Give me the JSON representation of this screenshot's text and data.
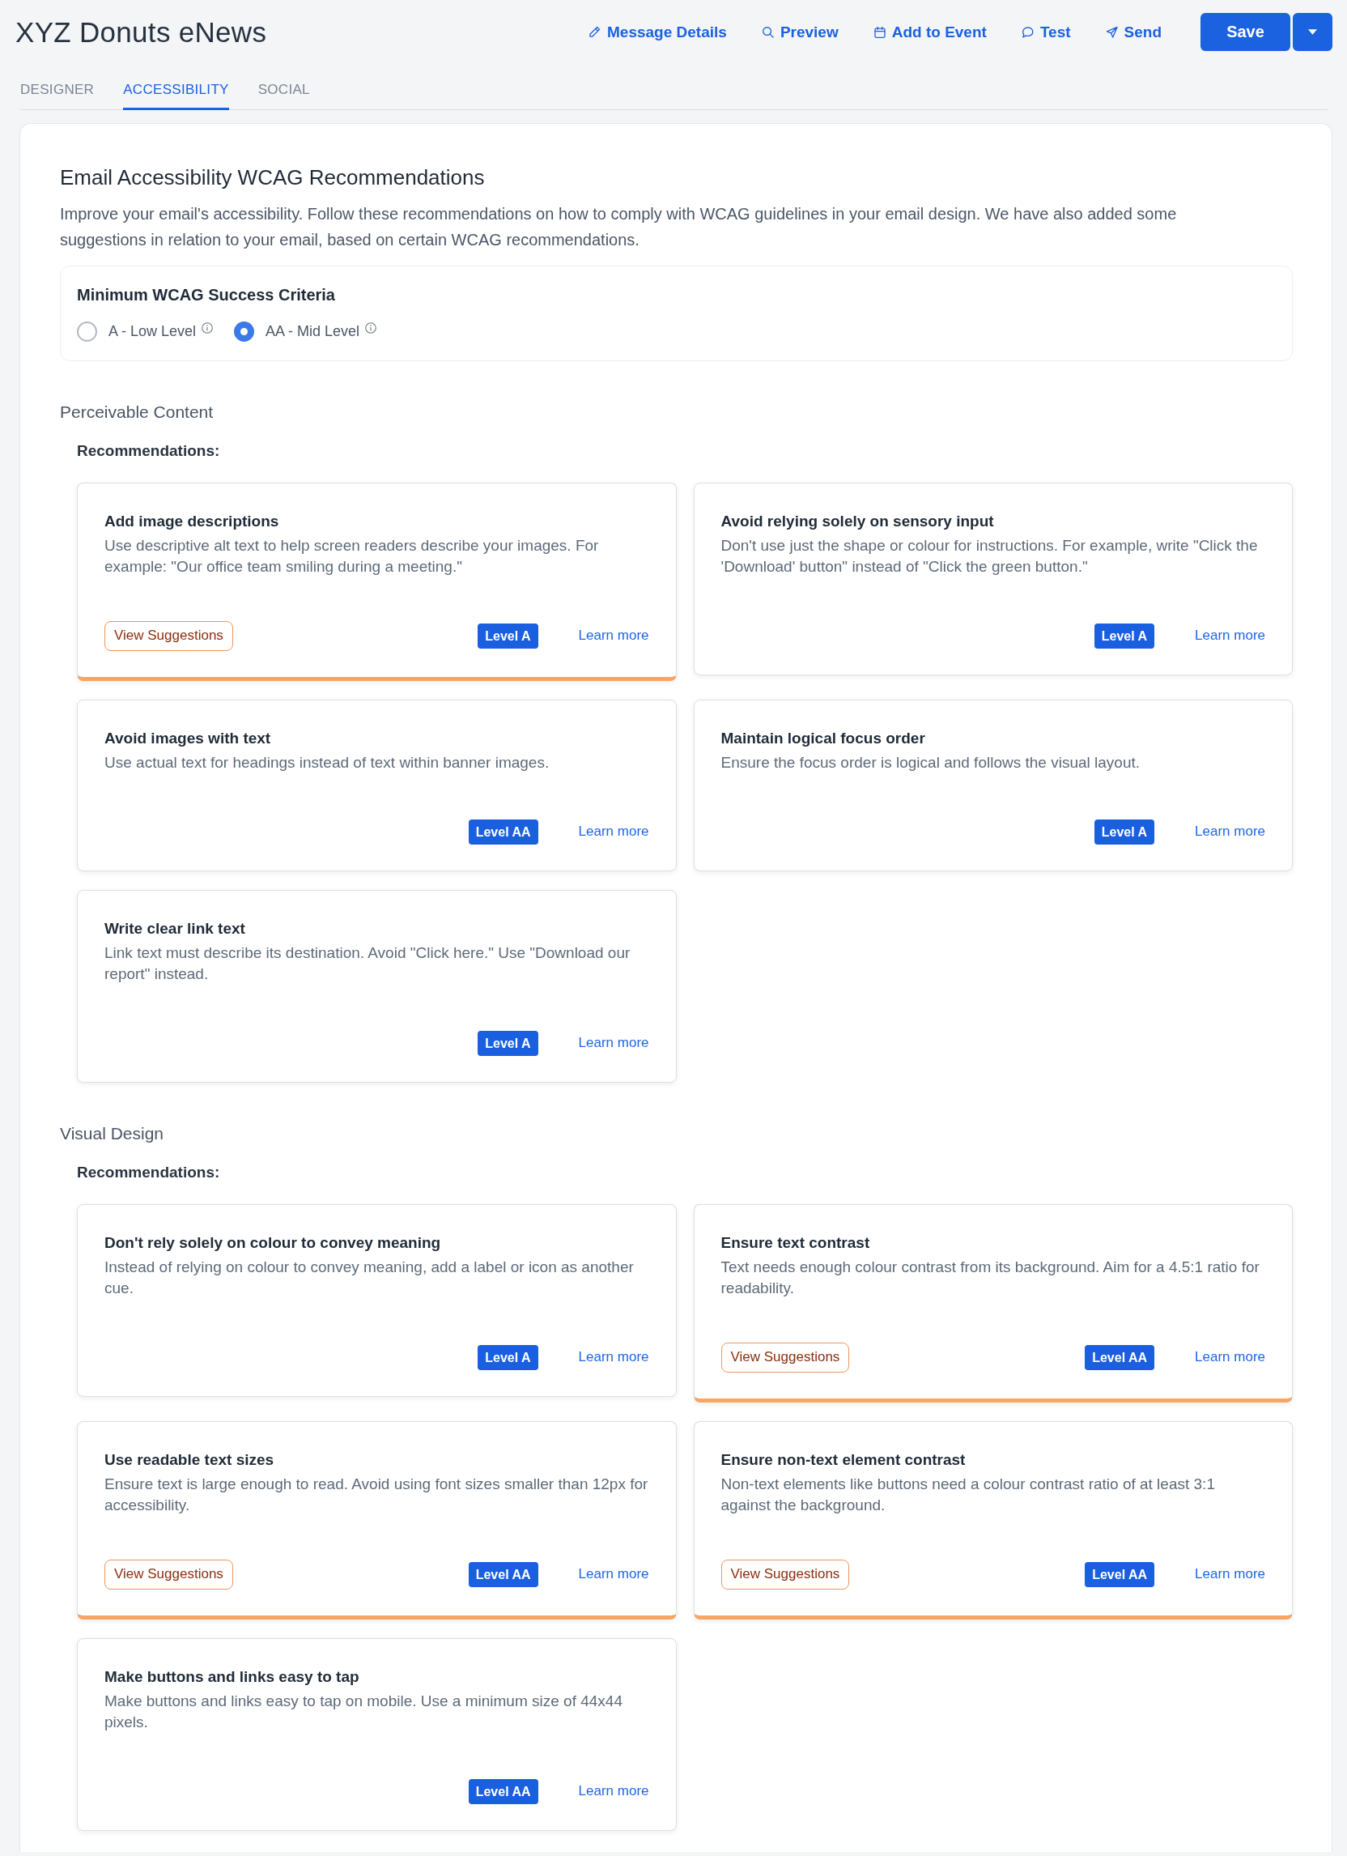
{
  "header": {
    "title": "XYZ Donuts eNews",
    "actions": [
      {
        "kind": "details",
        "label": "Message Details"
      },
      {
        "kind": "preview",
        "label": "Preview"
      },
      {
        "kind": "event",
        "label": "Add to Event"
      },
      {
        "kind": "test",
        "label": "Test"
      },
      {
        "kind": "send",
        "label": "Send"
      }
    ],
    "save_button": "Save"
  },
  "tabs": [
    {
      "label": "DESIGNER",
      "selected": false
    },
    {
      "label": "ACCESSIBILITY",
      "selected": true
    },
    {
      "label": "SOCIAL",
      "selected": false
    }
  ],
  "panel": {
    "title": "Email Accessibility WCAG Recommendations",
    "intro": "Improve your email's accessibility. Follow these recommendations on how to comply with WCAG guidelines in your email design. We have also added some suggestions in relation to your email, based on certain WCAG recommendations.",
    "criteria": {
      "title": "Minimum WCAG Success Criteria",
      "options": [
        {
          "label": "A - Low Level",
          "selected": false
        },
        {
          "label": "AA - Mid Level",
          "selected": true
        }
      ]
    }
  },
  "sections": [
    {
      "title": "Perceivable Content",
      "subtitle": "Recommendations:",
      "cards": [
        {
          "title": "Add image descriptions",
          "description": "Use descriptive alt text to help screen readers describe your images. For example: \"Our office team smiling during a meeting.\"",
          "suggestions_button": "View Suggestions",
          "level": "Level A",
          "link": "Learn more"
        },
        {
          "title": "Avoid relying solely on sensory input",
          "description": "Don't use just the shape or colour for instructions. For example, write \"Click the 'Download' button\" instead of \"Click the green button.\"",
          "level": "Level A",
          "link": "Learn more"
        },
        {
          "title": "Avoid images with text",
          "description": "Use actual text for headings instead of text within banner images.",
          "level": "Level AA",
          "link": "Learn more"
        },
        {
          "title": "Maintain logical focus order",
          "description": "Ensure the focus order is logical and follows the visual layout.",
          "level": "Level A",
          "link": "Learn more"
        },
        {
          "title": "Write clear link text",
          "description": "Link text must describe its destination. Avoid \"Click here.\" Use \"Download our report\" instead.",
          "level": "Level A",
          "link": "Learn more"
        }
      ]
    },
    {
      "title": "Visual Design",
      "subtitle": "Recommendations:",
      "cards": [
        {
          "title": "Don't rely solely on colour to convey meaning",
          "description": "Instead of relying on colour to convey meaning, add a label or icon as another cue.",
          "level": "Level A",
          "link": "Learn more"
        },
        {
          "title": "Ensure text contrast",
          "description": "Text needs enough colour contrast from its background. Aim for a 4.5:1 ratio for readability.",
          "suggestions_button": "View Suggestions",
          "level": "Level AA",
          "link": "Learn more"
        },
        {
          "title": "Use readable text sizes",
          "description": "Ensure text is large enough to read. Avoid using font sizes smaller than 12px for accessibility.",
          "suggestions_button": "View Suggestions",
          "level": "Level AA",
          "link": "Learn more"
        },
        {
          "title": "Ensure non-text element contrast",
          "description": "Non-text elements like buttons need a colour contrast ratio of at least 3:1 against the background.",
          "suggestions_button": "View Suggestions",
          "level": "Level AA",
          "link": "Learn more"
        },
        {
          "title": "Make buttons and links easy to tap",
          "description": "Make buttons and links easy to tap on mobile. Use a minimum size of 44x44 pixels.",
          "level": "Level AA",
          "link": "Learn more"
        }
      ]
    }
  ]
}
